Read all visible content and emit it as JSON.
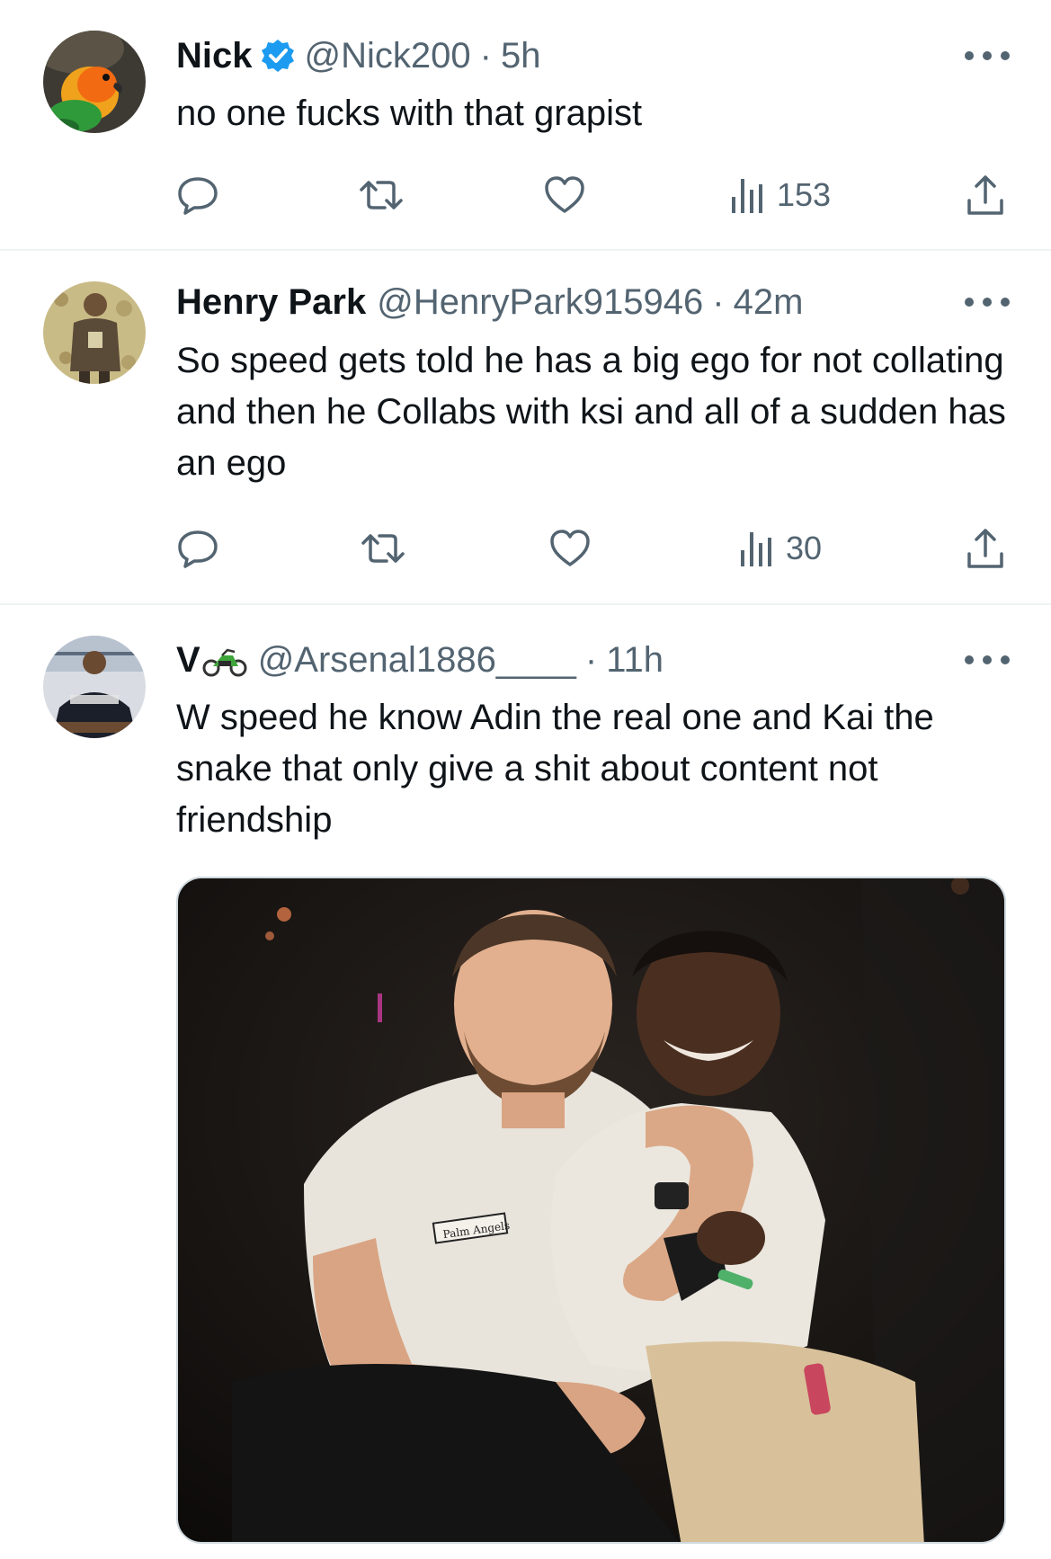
{
  "tweets": [
    {
      "name": "Nick",
      "handle": "@Nick200",
      "dot": "·",
      "time": "5h",
      "verified": true,
      "text": "no one fucks with that grapist",
      "views": "153"
    },
    {
      "name": "Henry Park",
      "handle": "@HenryPark915946",
      "dot": "·",
      "time": "42m",
      "verified": false,
      "text": "So speed gets told he has a big ego for not collating and then he Collabs with ksi and all of a sudden has an ego",
      "views": "30"
    },
    {
      "name": "V",
      "name_emoji": "motorcycle-emoji",
      "handle": "@Arsenal1886____",
      "dot": "·",
      "time": "11h",
      "verified": false,
      "text": "W speed he know Adin the real one and Kai the snake that only give a shit about content not friendship",
      "media_shirt_text": "Palm Angels"
    }
  ],
  "icons": {
    "reply": "reply-icon",
    "retweet": "retweet-icon",
    "like": "heart-icon",
    "views": "views-icon",
    "share": "share-icon",
    "more": "more-icon",
    "verified": "verified-badge-icon"
  },
  "colors": {
    "text": "#0f1419",
    "secondary": "#536471",
    "verified": "#1d9bf0",
    "divider": "#eff3f4"
  }
}
